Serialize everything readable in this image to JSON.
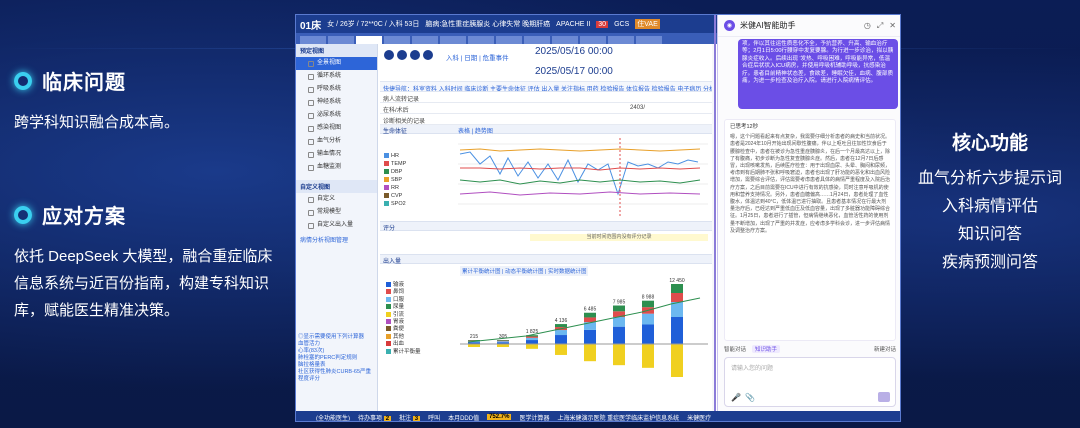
{
  "slide": {
    "problem_title": "临床问题",
    "problem_text": "跨学科知识融合成本高。",
    "solution_title": "应对方案",
    "solution_text": "依托 DeepSeek 大模型，融合重症临床信息系统与近百份指南，构建专科知识库，赋能医生精准决策。",
    "core_title": "核心功能",
    "core_items": [
      "血气分析六步提示词",
      "入科病情评估",
      "知识问答",
      "疾病预测问答"
    ]
  },
  "app": {
    "bed": "01床",
    "patient_info": "女 / 26岁 / 72**0C / 入科 53日",
    "diagnosis": "脑病:急性重症胰腺炎 心律失常 晚期肝癌",
    "tag1": "APACHE II",
    "tag1_val": "30",
    "tag2": "GCS",
    "tag2_val": "住VAE",
    "date_start": "2025/05/16 00:00",
    "date_end": "2025/05/17 00:00",
    "nav_links": "入科 | 日期 | 危重事件",
    "link_row": "快捷导航：科室资料  入科时间  临床诊断  主要生命体征  评估  出入量  关注指标  用药  检验报告  体位报告  检验报告  电子病历  分析",
    "row1": "病人流转记录",
    "row2_label": "在科/术后",
    "row2_val": "2403/",
    "row3": "诊断相关的记录",
    "vital_section": "生命体征",
    "vital_tabs": "表格 | 趋势图",
    "vital_legend": [
      "HR",
      "TEMP",
      "DBP",
      "SBP",
      "RR",
      "CVP",
      "SPO2"
    ],
    "score_section": "评分",
    "score_bar": "当前时间范围内没有评分记录",
    "io_section": "出入量",
    "io_tabs": "累计平衡统计图 | 动态平衡统计图 | 实时数据统计图",
    "io_legend": [
      "输液",
      "鼻饲",
      "口服",
      "尿量",
      "引流",
      "胃液",
      "粪便",
      "其他",
      "出血",
      "累计平衡量"
    ],
    "bar_labels": [
      "215",
      "305",
      "1 825",
      "4 136",
      "6 485",
      "7 985",
      "8 988",
      "12 450"
    ]
  },
  "sidebar": {
    "header1": "预定视图",
    "items": [
      "全景视图",
      "循环系统",
      "呼吸系统",
      "神经系统",
      "泌尿系统",
      "感染视图",
      "血气分析",
      "输血情况",
      "血糖监测"
    ],
    "header2": "自定义视图",
    "custom": [
      "自定义",
      "常规模型",
      "自定义出入量"
    ],
    "link": "病情分析视图管理",
    "notes": "◎显示需要使用下列计算器\n血管活力\n心率(83次)\n肺栓塞的PERC判定规则\n脑拉格量表\n社区获得性肺炎CURB-65严重程度评分"
  },
  "ai": {
    "title": "米健AI智能助手",
    "question": "项，伴以其往运性质恶化不全，予抗营养、升高、输血治疗等；2月1日5:00行腰穿中发复要腺。为行进一步诊治，拟以胰腺炎症收入。后续出现 '发热、呼吸困难，呼吸能异常，低温合症后状状入ICU病房，并使用呼吸机辅助呼吸，抗感染治疗。患者目前精神状态差，食欲差，睡眠欠佳，血病、腹部质痛，为进一步检查及治疗入院。请进行入院病情评估。",
    "answer_title": "已思考12秒",
    "answer": "嗯，这个问题看起来有点复杂，我需要仔细分析患者的病史和当前状况。患者是2024年10月开始出现间歇性腹痛，伴以上呕吐且往加性饮食后于腰腺检查中，患者在被诊为急性重症胰腺炎，在后一个月最高达以上，除了有腹痛，初步诊断为急性复查胰腺炎症。然后，患者在12月7日后感冒，出现咳嗽发热，后续医疗检查：用于出现血尿、头晕、胸闷和尿频，考虑到有后期肺不张和呼吸窘迫，患者也出现了肝功能的恶化和出血风险增加，需要综合评估，评估需要考虑患者具体的病情严重程度及入院后治疗方案，之后目前需要在ICU中进行有效的抗感染，同时注意呼吸机的使用和营养支持情况。另外，患者血糖偏高……1月24日，患者处理了血性腹水，体温达到40°C，低体温已进行抽取。且患者基本情况在行最大剂量治疗后，已经达到严重低血压及低血容量，出现了多脏器功能障碍综合征。1月25日，患者进行了插管，但病情继续恶化，血管活性药的使用剂量不断增加，出现了严重的并发症，应考虑多学科会诊，进一步评估病情及调整治疗方案。",
    "actions": [
      "智能对话",
      "知识助手"
    ],
    "new_chat": "新建对话",
    "input_placeholder": "请输入您的问题"
  },
  "statusbar": {
    "user": "(全功能医生)",
    "todo": "待办事项",
    "todo_count": "2",
    "approve": "批注",
    "approve_count": "3",
    "call": "呼叫",
    "ddd_label": "本月DDD值",
    "ddd_val": "752.7%",
    "calc": "医学计算器",
    "hospital": "上海米健演示医院 重症医学临床监护信息系统",
    "brand": "米健医疗"
  },
  "colors": {
    "accent": "#6b4ee6",
    "brand": "#1c3d8f",
    "ring": "#3ad0f0"
  }
}
